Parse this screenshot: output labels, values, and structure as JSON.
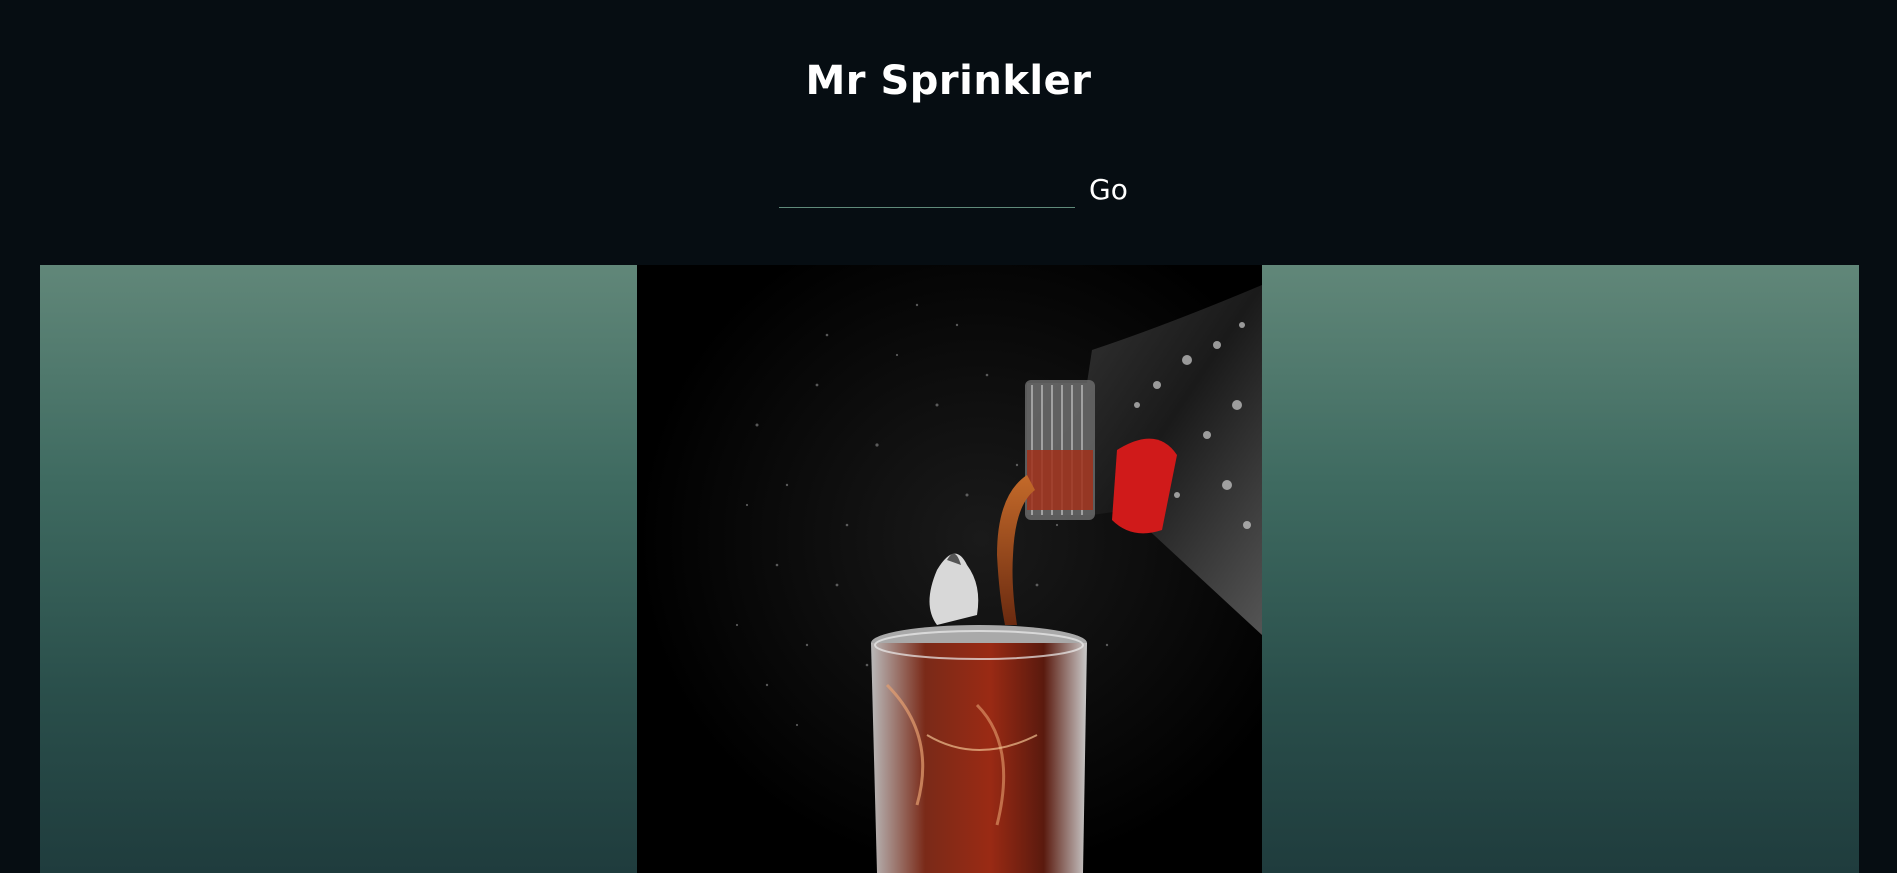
{
  "site": {
    "title": "Mr Sprinkler"
  },
  "search": {
    "value": "",
    "placeholder": "",
    "go_label": "Go"
  },
  "gallery": {
    "left_panel": "gradient-panel",
    "center_image": "soda-pouring-image",
    "right_panel": "gradient-panel"
  },
  "colors": {
    "page_background": "#060d12",
    "panel_gradient_top": "#618779",
    "panel_gradient_bottom": "#1f3c3d",
    "title_text": "#ffffff",
    "input_underline": "#5f8a7a"
  }
}
